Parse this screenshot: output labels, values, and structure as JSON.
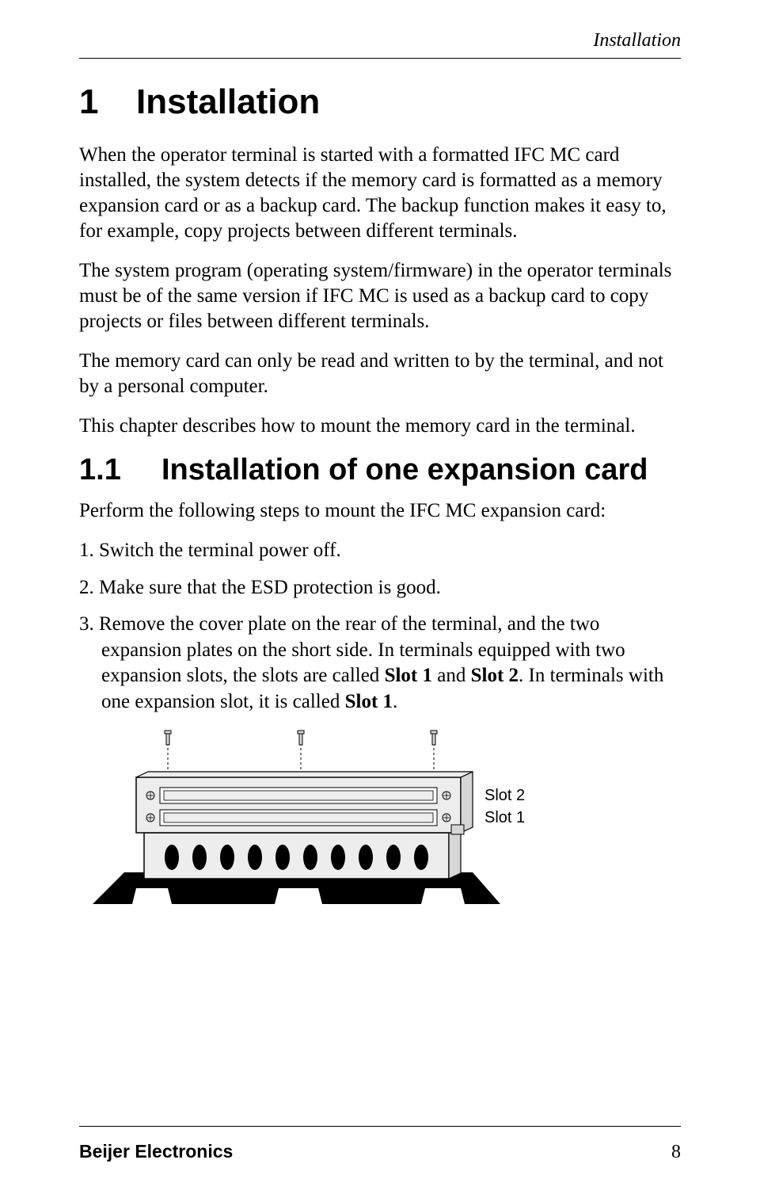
{
  "running_head": "Installation",
  "chapter": {
    "number": "1",
    "title": "Installation"
  },
  "paragraphs": {
    "p1": "When the operator terminal is started with a formatted IFC MC card installed, the system detects if the memory card is formatted as a memory expansion card or as a backup card. The backup function makes it easy to, for example, copy projects between different terminals.",
    "p2": "The system program (operating system/firmware) in the operator terminals must be of the same version if IFC MC is used as a backup card to copy projects or files between different terminals.",
    "p3": "The memory card can only be read and written to by the terminal, and not by a personal computer.",
    "p4": "This chapter describes how to mount the memory card in the terminal."
  },
  "section": {
    "number": "1.1",
    "title": "Installation of one expansion card",
    "intro": "Perform the following steps to mount the IFC MC expansion card:"
  },
  "steps": {
    "s1": "Switch the terminal power off.",
    "s2": "Make sure that the ESD protection is good.",
    "s3_a": "Remove the cover plate on the rear of the terminal, and the two expansion plates on the short side. In terminals equipped with two expansion slots, the slots are called ",
    "s3_b": "Slot 1",
    "s3_c": " and ",
    "s3_d": "Slot 2",
    "s3_e": ". In terminals with one expansion slot, it is called ",
    "s3_f": "Slot 1",
    "s3_g": "."
  },
  "figure": {
    "label_top": "Slot 2",
    "label_bottom": "Slot 1"
  },
  "footer": {
    "brand": "Beijer Electronics",
    "page": "8"
  }
}
